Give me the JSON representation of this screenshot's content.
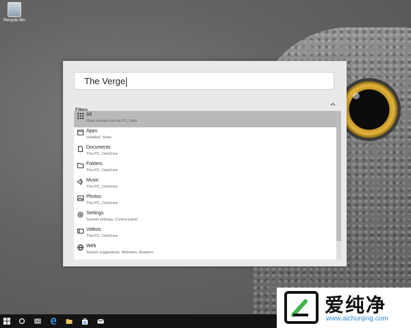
{
  "desktop": {
    "recycle_bin_label": "Recycle Bin"
  },
  "search": {
    "query": "The Verge"
  },
  "filters": {
    "label": "Filters",
    "items": [
      {
        "title": "All",
        "subtitle": "Most relevant on this PC, Web",
        "icon": "grid-icon",
        "selected": true
      },
      {
        "title": "Apps",
        "subtitle": "Installed, Store",
        "icon": "apps-icon",
        "selected": false
      },
      {
        "title": "Documents",
        "subtitle": "This PC, OneDrive",
        "icon": "document-icon",
        "selected": false
      },
      {
        "title": "Folders",
        "subtitle": "This PC, OneDrive",
        "icon": "folder-icon",
        "selected": false
      },
      {
        "title": "Music",
        "subtitle": "This PC, OneDrive",
        "icon": "music-icon",
        "selected": false
      },
      {
        "title": "Photos",
        "subtitle": "This PC, OneDrive",
        "icon": "photo-icon",
        "selected": false
      },
      {
        "title": "Settings",
        "subtitle": "System settings, Control panel",
        "icon": "gear-icon",
        "selected": false
      },
      {
        "title": "Videos",
        "subtitle": "This PC, OneDrive",
        "icon": "video-icon",
        "selected": false
      },
      {
        "title": "Web",
        "subtitle": "Search suggestions, Websites, Answers",
        "icon": "globe-icon",
        "selected": false
      }
    ]
  },
  "taskbar": {
    "icons": [
      "windows-start-icon",
      "cortana-icon",
      "task-view-icon",
      "edge-icon",
      "file-explorer-icon",
      "store-icon",
      "mail-icon"
    ]
  },
  "watermark": {
    "chinese_text": "爱纯净",
    "url": "www.aichunjing.com"
  },
  "colors": {
    "selected_row": "#b9b9b9",
    "panel_bg": "#e9e9e9",
    "taskbar_bg": "#141414",
    "edge_blue": "#3a8ccf",
    "owl_eye_gold": "#e3b53b"
  }
}
